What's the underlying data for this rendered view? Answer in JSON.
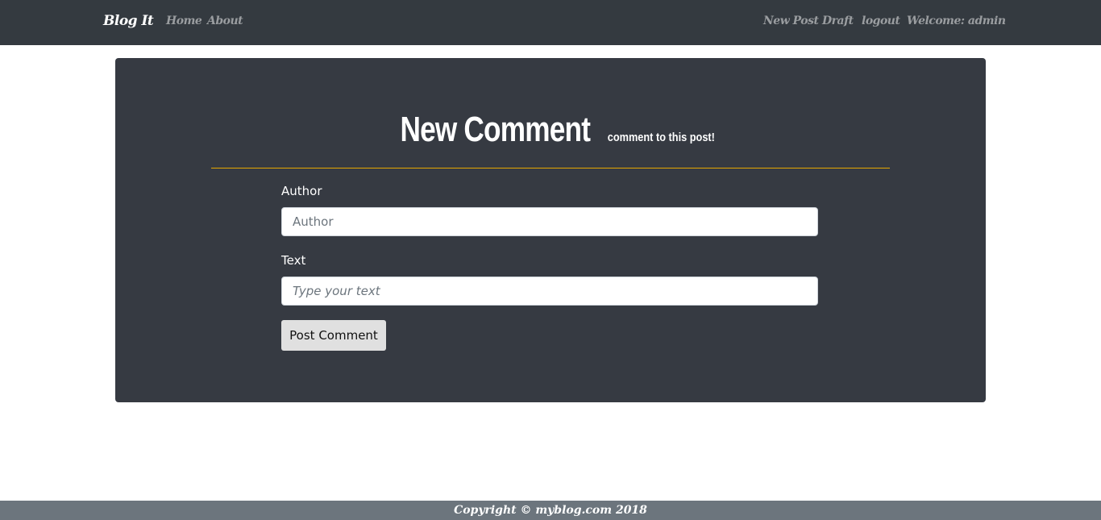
{
  "nav": {
    "brand": "Blog It",
    "home": "Home",
    "about": "About",
    "new_post": "New Post",
    "draft": "Draft",
    "logout": "logout",
    "welcome": "Welcome: admin"
  },
  "form": {
    "title": "New Comment",
    "subtitle": "comment to this post!",
    "author_label": "Author",
    "author_placeholder": "Author",
    "text_label": "Text",
    "text_placeholder": "Type your text",
    "submit": "Post Comment"
  },
  "footer": {
    "text": "Copyright © myblog.com 2018"
  }
}
